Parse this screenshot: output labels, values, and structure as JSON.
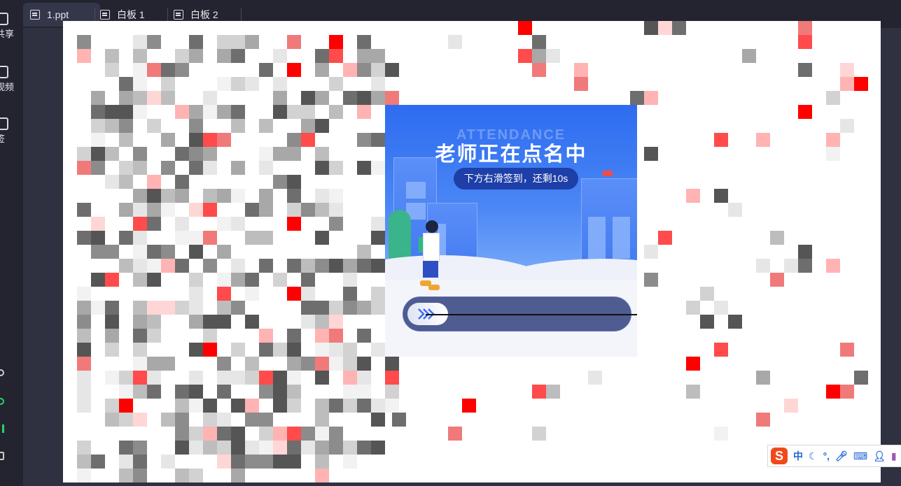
{
  "sidebar": {
    "items": [
      {
        "label": "共享",
        "icon": "share-screen-icon"
      },
      {
        "label": "视频",
        "icon": "video-icon"
      },
      {
        "label": "签",
        "icon": "sign-in-icon"
      }
    ]
  },
  "tabs": [
    {
      "label": "1.ppt",
      "active": true
    },
    {
      "label": "白板 1",
      "active": false
    },
    {
      "label": "白板 2",
      "active": false
    }
  ],
  "attendance": {
    "watermark": "ATTENDANCE",
    "title": "老师正在点名中",
    "subtitle": "下方右滑签到，还剩10s",
    "slider_icon": "chevrons-right-icon"
  },
  "ime": {
    "logo": "S",
    "mode": "中",
    "icons": [
      "moon-icon",
      "punctuation-icon",
      "microphone-icon",
      "keyboard-icon",
      "user-icon",
      "skin-icon"
    ]
  },
  "colors": {
    "accent_blue": "#2d6cf0",
    "mosaic_red": "#ff0000",
    "sidebar_bg": "#23242f",
    "ime_orange": "#f04a1a"
  }
}
